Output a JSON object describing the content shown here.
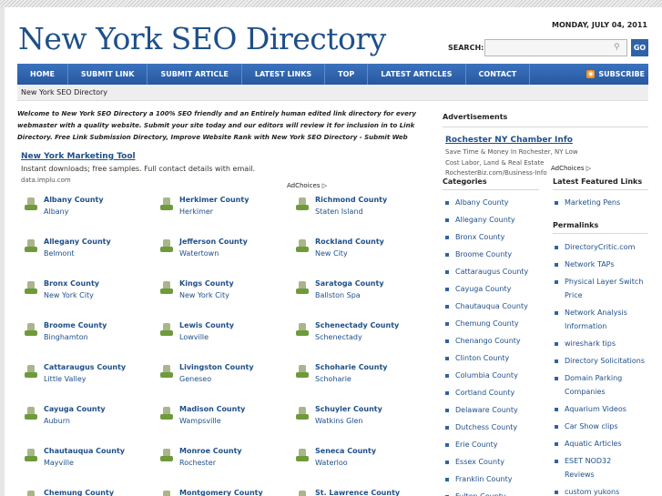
{
  "header": {
    "date": "MONDAY, JULY 04, 2011",
    "site_title": "New York SEO Directory",
    "search_label": "SEARCH:",
    "search_placeholder": "",
    "go_label": "GO"
  },
  "nav": {
    "items": [
      "HOME",
      "SUBMIT LINK",
      "SUBMIT ARTICLE",
      "LATEST LINKS",
      "TOP",
      "LATEST ARTICLES",
      "CONTACT"
    ],
    "subscribe": "SUBSCRIBE"
  },
  "breadcrumb": "New York SEO Directory",
  "intro": "Welcome to New York SEO Directory a 100% SEO friendly and an Entirely human edited link directory for every webmaster with a quality website. Submit your site today and our editors will review it for inclusion in to Link Directory. Free Link Submission Directory, Improve Website Rank with New York SEO Directory - Submit Web",
  "ad_main": {
    "title": "New York Marketing Tool",
    "text": "Instant downloads; free samples. Full contact details with email.",
    "url": "data.implu.com",
    "adchoices": "AdChoices ▷"
  },
  "counties": [
    {
      "name": "Albany County",
      "city": "Albany"
    },
    {
      "name": "Herkimer County",
      "city": "Herkimer"
    },
    {
      "name": "Richmond County",
      "city": "Staten Island"
    },
    {
      "name": "Allegany County",
      "city": "Belmont"
    },
    {
      "name": "Jefferson County",
      "city": "Watertown"
    },
    {
      "name": "Rockland County",
      "city": "New City"
    },
    {
      "name": "Bronx County",
      "city": "New York City"
    },
    {
      "name": "Kings County",
      "city": "New York City"
    },
    {
      "name": "Saratoga County",
      "city": "Ballston Spa"
    },
    {
      "name": "Broome County",
      "city": "Binghamton"
    },
    {
      "name": "Lewis County",
      "city": "Lowville"
    },
    {
      "name": "Schenectady County",
      "city": "Schenectady"
    },
    {
      "name": "Cattaraugus County",
      "city": "Little Valley"
    },
    {
      "name": "Livingston County",
      "city": "Geneseo"
    },
    {
      "name": "Schoharie County",
      "city": "Schoharie"
    },
    {
      "name": "Cayuga County",
      "city": "Auburn"
    },
    {
      "name": "Madison County",
      "city": "Wampsville"
    },
    {
      "name": "Schuyler County",
      "city": "Watkins Glen"
    },
    {
      "name": "Chautauqua County",
      "city": "Mayville"
    },
    {
      "name": "Monroe County",
      "city": "Rochester"
    },
    {
      "name": "Seneca County",
      "city": "Waterloo"
    },
    {
      "name": "Chemung County",
      "city": ""
    },
    {
      "name": "Montgomery County",
      "city": ""
    },
    {
      "name": "St. Lawrence County",
      "city": ""
    }
  ],
  "sidebar": {
    "advertisements_heading": "Advertisements",
    "ad": {
      "title": "Rochester NY Chamber Info",
      "line1": "Save Time & Money In Rochester, NY Low",
      "line2": "Cost Labor, Land & Real Estate",
      "line3": "RochesterBiz.com/Business-Info",
      "adchoices": "AdChoices ▷"
    },
    "categories_heading": "Categories",
    "categories": [
      "Albany County",
      "Allegany County",
      "Bronx County",
      "Broome County",
      "Cattaraugus County",
      "Cayuga County",
      "Chautauqua County",
      "Chemung County",
      "Chenango County",
      "Clinton County",
      "Columbia County",
      "Cortland County",
      "Delaware County",
      "Dutchess County",
      "Erie County",
      "Essex County",
      "Franklin County",
      "Fulton County"
    ],
    "featured_heading": "Latest Featured Links",
    "featured": [
      "Marketing Pens"
    ],
    "permalinks_heading": "Permalinks",
    "permalinks": [
      [
        "DirectoryCritic.com"
      ],
      [
        "Network TAPs"
      ],
      [
        "Physical Layer Switch",
        "Price"
      ],
      [
        "Network Analysis",
        "Information"
      ],
      [
        "wireshark tips"
      ],
      [
        "Directory Solicitations"
      ],
      [
        "Domain Parking",
        "Companies"
      ],
      [
        "Aquarium Videos"
      ],
      [
        "Car Show clips"
      ],
      [
        "Aquatic Articles"
      ],
      [
        "ESET NOD32",
        "Reviews"
      ],
      [
        "custom yukons"
      ]
    ]
  },
  "colors": {
    "link_blue": "#1e4f8a",
    "nav_blue": "#2f62a8",
    "pin_green": "#6f9a3b",
    "rss_orange": "#f7931e"
  }
}
